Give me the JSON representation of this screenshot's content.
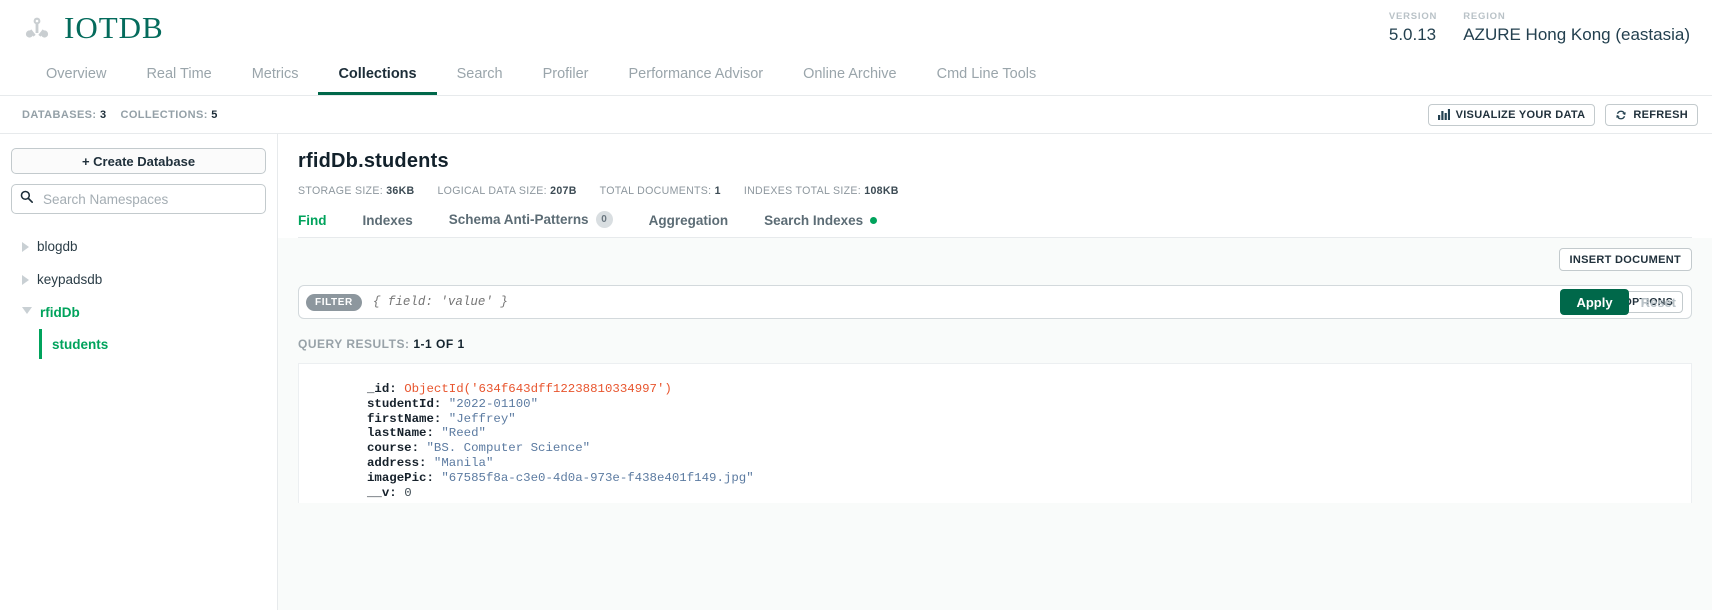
{
  "brand": {
    "name": "IOTDB",
    "icon": "atom-icon"
  },
  "header": {
    "version_label": "VERSION",
    "version_value": "5.0.13",
    "region_label": "REGION",
    "region_value": "AZURE Hong Kong (eastasia)"
  },
  "nav": {
    "tabs": [
      {
        "label": "Overview",
        "active": false
      },
      {
        "label": "Real Time",
        "active": false
      },
      {
        "label": "Metrics",
        "active": false
      },
      {
        "label": "Collections",
        "active": true
      },
      {
        "label": "Search",
        "active": false
      },
      {
        "label": "Profiler",
        "active": false
      },
      {
        "label": "Performance Advisor",
        "active": false
      },
      {
        "label": "Online Archive",
        "active": false
      },
      {
        "label": "Cmd Line Tools",
        "active": false
      }
    ]
  },
  "statsbar": {
    "databases_label": "DATABASES:",
    "databases_value": "3",
    "collections_label": "COLLECTIONS:",
    "collections_value": "5",
    "visualize_label": "VISUALIZE YOUR DATA",
    "refresh_label": "REFRESH"
  },
  "sidebar": {
    "create_label": "+ Create Database",
    "search_placeholder": "Search Namespaces",
    "items": [
      {
        "label": "blogdb",
        "expanded": false,
        "selected": false
      },
      {
        "label": "keypadsdb",
        "expanded": false,
        "selected": false
      },
      {
        "label": "rfidDb",
        "expanded": true,
        "selected": true
      }
    ],
    "child_label": "students"
  },
  "collection": {
    "title": "rfidDb.students",
    "stats": [
      {
        "label": "STORAGE SIZE:",
        "value": "36KB"
      },
      {
        "label": "LOGICAL DATA SIZE:",
        "value": "207B"
      },
      {
        "label": "TOTAL DOCUMENTS:",
        "value": "1"
      },
      {
        "label": "INDEXES TOTAL SIZE:",
        "value": "108KB"
      }
    ],
    "subtabs": [
      {
        "label": "Find",
        "active": true
      },
      {
        "label": "Indexes",
        "active": false
      },
      {
        "label": "Schema Anti-Patterns",
        "active": false,
        "badge": "0"
      },
      {
        "label": "Aggregation",
        "active": false
      },
      {
        "label": "Search Indexes",
        "active": false,
        "dot": true
      }
    ]
  },
  "query": {
    "insert_label": "INSERT DOCUMENT",
    "filter_chip": "FILTER",
    "filter_placeholder": "{ field: 'value' }",
    "filter_value": "",
    "options_label": "OPTIONS",
    "apply_label": "Apply",
    "reset_label": "Reset",
    "results_label": "QUERY RESULTS:",
    "results_count": "1-1 OF 1"
  },
  "document": {
    "fields": [
      {
        "key": "_id",
        "value": "ObjectId('634f643dff12238810334997')",
        "type": "oid"
      },
      {
        "key": "studentId",
        "value": "\"2022-01100\"",
        "type": "str"
      },
      {
        "key": "firstName",
        "value": "\"Jeffrey\"",
        "type": "str"
      },
      {
        "key": "lastName",
        "value": "\"Reed\"",
        "type": "str"
      },
      {
        "key": "course",
        "value": "\"BS. Computer Science\"",
        "type": "str"
      },
      {
        "key": "address",
        "value": "\"Manila\"",
        "type": "str"
      },
      {
        "key": "imagePic",
        "value": "\"67585f8a-c3e0-4d0a-973e-f438e401f149.jpg\"",
        "type": "str"
      },
      {
        "key": "__v",
        "value": "0",
        "type": "num"
      }
    ]
  },
  "colors": {
    "brand_green": "#046b5c",
    "accent_green": "#00a35c",
    "active_underline": "#00684a",
    "string_blue": "#5c7ba1",
    "objectid_orange": "#e8552e"
  }
}
